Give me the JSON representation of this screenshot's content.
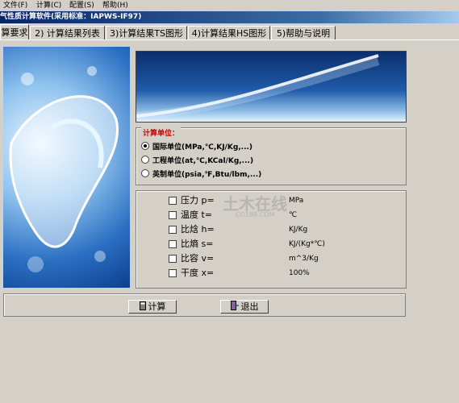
{
  "menu": [
    "文件(F)",
    "计算(C)",
    "配置(S)",
    "帮助(H)"
  ],
  "window_title": "气性质计算软件(采用标准：IAPWS-IF97)",
  "tabs": [
    {
      "label": "算要求"
    },
    {
      "label": "2) 计算结果列表"
    },
    {
      "label": "3)计算结果TS图形"
    },
    {
      "label": "4)计算结果HS图形"
    },
    {
      "label": "5)帮助与说明"
    }
  ],
  "units_group": {
    "title": "计算单位：",
    "options": [
      {
        "label": "国际单位(MPa,℃,KJ/Kg,...)",
        "selected": true
      },
      {
        "label": "工程单位(at,℃,KCal/Kg,...)",
        "selected": false
      },
      {
        "label": "英制单位(psia,℉,Btu/lbm,...)",
        "selected": false
      }
    ]
  },
  "params": [
    {
      "label": "压力 p=",
      "unit": "MPa",
      "checked": false
    },
    {
      "label": "温度 t=",
      "unit": "℃",
      "checked": false
    },
    {
      "label": "比焓 h=",
      "unit": "KJ/Kg",
      "checked": false
    },
    {
      "label": "比熵 s=",
      "unit": "KJ/(Kg*℃)",
      "checked": false
    },
    {
      "label": "比容 v=",
      "unit": "m^3/Kg",
      "checked": false
    },
    {
      "label": "干度 x=",
      "unit": "100%",
      "checked": false
    }
  ],
  "buttons": {
    "calc": "计算",
    "exit": "退出"
  },
  "watermark": {
    "main": "土木在线",
    "sub": "CO188.COM"
  },
  "colors": {
    "group_title": "#cc0000",
    "titlebar": "#0a246a"
  }
}
